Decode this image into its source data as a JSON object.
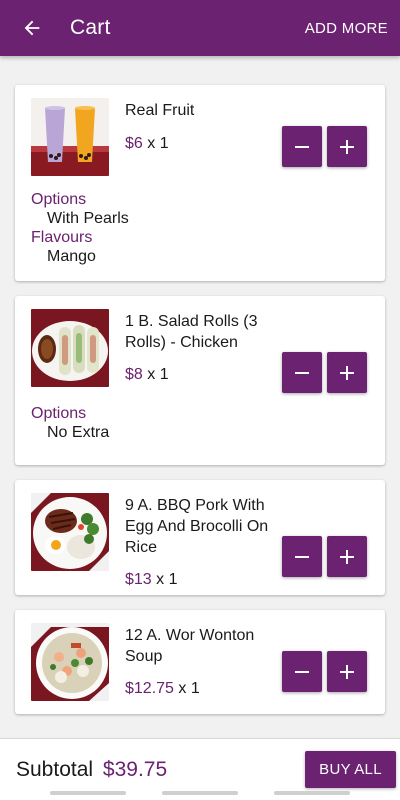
{
  "app_bar": {
    "title": "Cart",
    "add_more_label": "ADD MORE",
    "color": "#6b2270"
  },
  "cart": {
    "items": [
      {
        "name": "Real Fruit",
        "price": "$6",
        "quantity_text": " x 1",
        "options": [
          {
            "label": "Options",
            "value": "With Pearls"
          },
          {
            "label": "Flavours",
            "value": "Mango"
          }
        ],
        "image": "bubble-tea-photo"
      },
      {
        "name": "1 B. Salad Rolls (3 Rolls) - Chicken",
        "price": "$8",
        "quantity_text": " x 1",
        "options": [
          {
            "label": "Options",
            "value": "No Extra"
          }
        ],
        "image": "salad-rolls-photo"
      },
      {
        "name": "9 A. BBQ Pork With Egg And Brocolli On Rice",
        "price": "$13",
        "quantity_text": " x 1",
        "options": [],
        "image": "bbq-pork-rice-photo"
      },
      {
        "name": "12 A. Wor Wonton Soup",
        "price": "$12.75",
        "quantity_text": " x 1",
        "options": [],
        "image": "wonton-soup-photo"
      }
    ],
    "decrement_symbol": "−",
    "increment_symbol": "+"
  },
  "footer": {
    "subtotal_label": "Subtotal",
    "subtotal_value": "$39.75",
    "buy_all_label": "BUY ALL"
  },
  "icons": {
    "back": "arrow-left-icon",
    "minus": "minus-icon",
    "plus": "plus-icon"
  }
}
